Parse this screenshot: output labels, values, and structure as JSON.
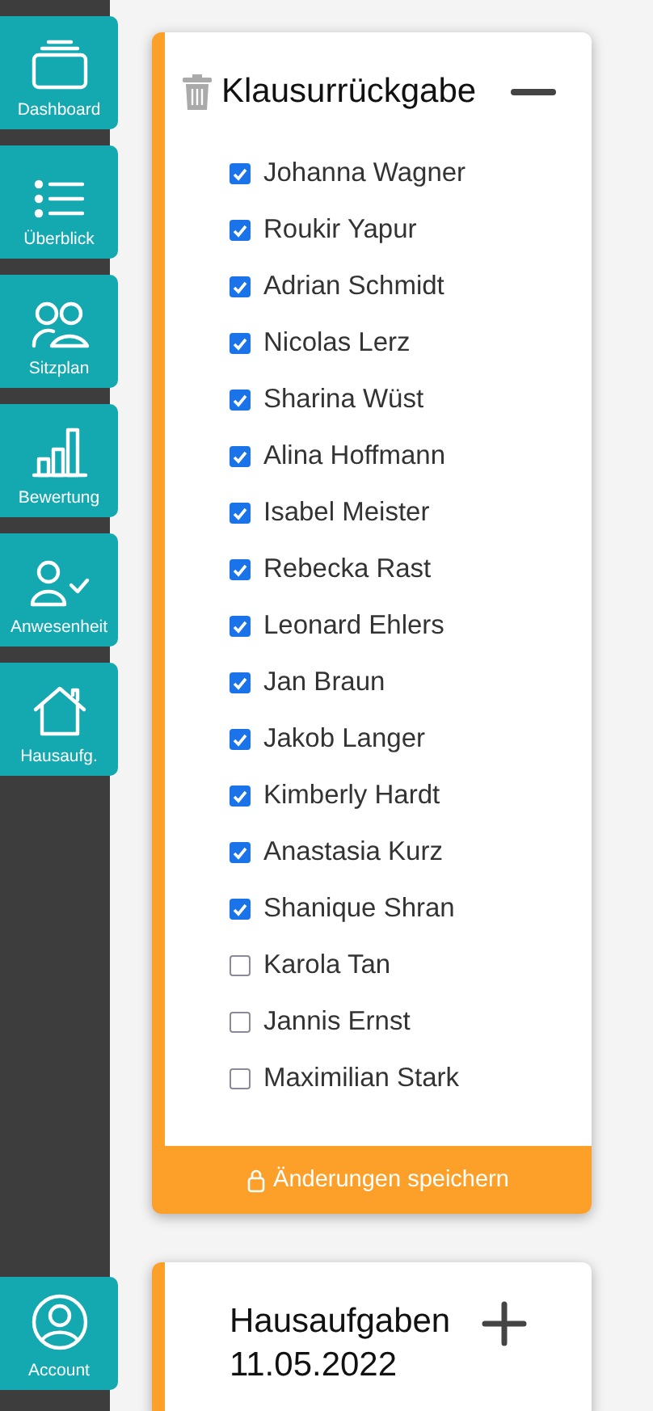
{
  "sidebar": {
    "items": [
      {
        "kind": "dashboard",
        "label": "Dashboard",
        "selected": false
      },
      {
        "kind": "list",
        "label": "Überblick",
        "selected": false
      },
      {
        "kind": "people",
        "label": "Sitzplan",
        "selected": false
      },
      {
        "kind": "chart",
        "label": "Bewertung",
        "selected": false
      },
      {
        "kind": "attendance",
        "label": "Anwesenheit",
        "selected": false
      },
      {
        "kind": "home",
        "label": "Hausaufg.",
        "selected": false
      }
    ],
    "account": {
      "label": "Account"
    }
  },
  "cards": [
    {
      "title": "Klausurrückgabe",
      "expanded": true,
      "students": [
        {
          "name": "Johanna Wagner",
          "checked": true
        },
        {
          "name": "Roukir Yapur",
          "checked": true
        },
        {
          "name": "Adrian Schmidt",
          "checked": true
        },
        {
          "name": "Nicolas Lerz",
          "checked": true
        },
        {
          "name": "Sharina Wüst",
          "checked": true
        },
        {
          "name": "Alina Hoffmann",
          "checked": true
        },
        {
          "name": "Isabel Meister",
          "checked": true
        },
        {
          "name": "Rebecka Rast",
          "checked": true
        },
        {
          "name": "Leonard Ehlers",
          "checked": true
        },
        {
          "name": "Jan Braun",
          "checked": true
        },
        {
          "name": "Jakob Langer",
          "checked": true
        },
        {
          "name": "Kimberly Hardt",
          "checked": true
        },
        {
          "name": "Anastasia Kurz",
          "checked": true
        },
        {
          "name": "Shanique Shran",
          "checked": true
        },
        {
          "name": "Karola Tan",
          "checked": false
        },
        {
          "name": "Jannis Ernst",
          "checked": false
        },
        {
          "name": "Maximilian Stark",
          "checked": false
        }
      ],
      "save_button": "Änderungen speichern"
    },
    {
      "title": "Hausaufgaben 11.05.2022",
      "expanded": false
    }
  ]
}
